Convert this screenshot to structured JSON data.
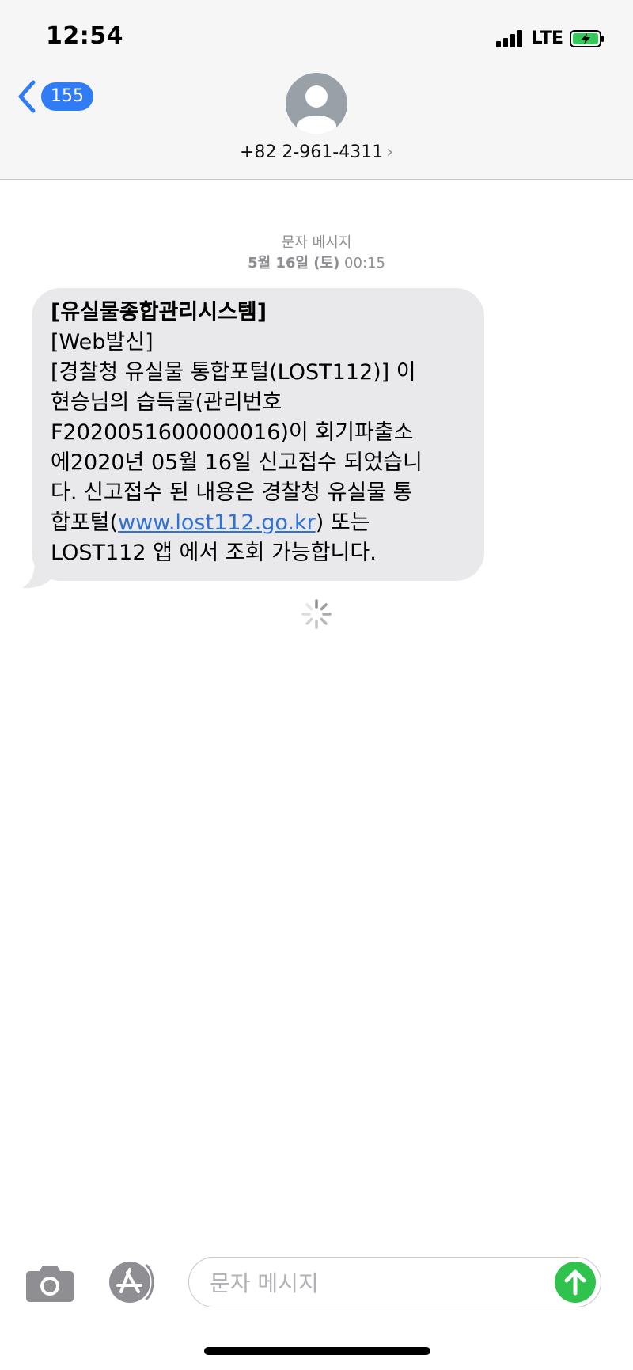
{
  "status_bar": {
    "time": "12:54",
    "network": "LTE"
  },
  "header": {
    "back_count": "155",
    "contact": "+82 2-961-4311",
    "chevron": "›"
  },
  "thread": {
    "service_label": "문자 메시지",
    "date": "5월 16일 (토)",
    "time": "00:15"
  },
  "message": {
    "title": "[유실물종합관리시스템]",
    "lines": [
      "[Web발신]",
      "[경찰청 유실물 통합포털(LOST112)] 이",
      "현승님의 습득물(관리번호",
      "F2020051600000016)이 회기파출소",
      "에2020년 05월 16일 신고접수 되었습니",
      "다. 신고접수 된 내용은  경찰청 유실물 통"
    ],
    "link_prefix": "합포털(",
    "link_text": "www.lost112.go.kr",
    "link_suffix": ") 또는",
    "last_line": "LOST112 앱 에서 조회 가능합니다."
  },
  "composer": {
    "placeholder": "문자 메시지"
  },
  "colors": {
    "accent": "#2f7cf6",
    "bubble": "#e9e9eb",
    "send": "#2fc24d",
    "link": "#2f72d6"
  },
  "icons": {
    "back": "chevron-left-icon",
    "avatar": "person-icon",
    "camera": "camera-icon",
    "appstore": "app-store-icon",
    "send": "arrow-up-icon",
    "spinner": "loading-spinner-icon"
  }
}
